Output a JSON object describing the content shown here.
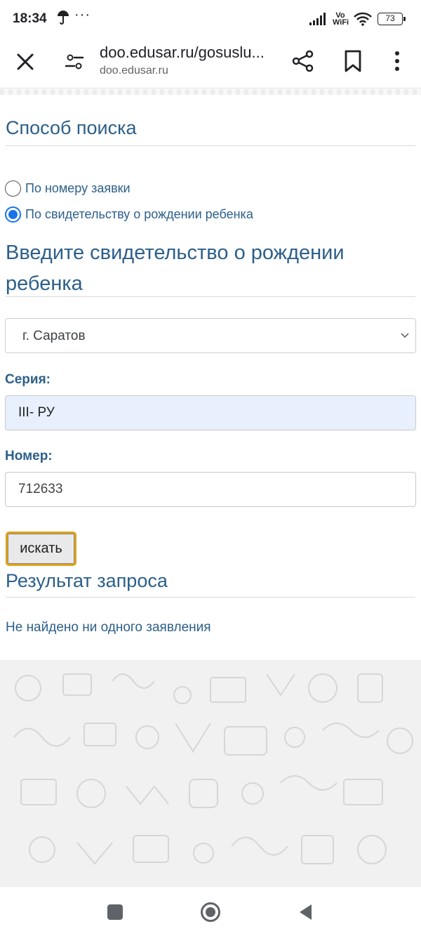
{
  "status_bar": {
    "time": "18:34",
    "dots": "···",
    "network_label_1": "Vo",
    "network_label_2": "WiFi",
    "battery": "73"
  },
  "browser": {
    "url": "doo.edusar.ru/gosuslu...",
    "domain": "doo.edusar.ru",
    "icons": [
      "close-icon",
      "tune-icon",
      "share-icon",
      "bookmark-icon",
      "more-vert-icon"
    ]
  },
  "search_method": {
    "title": "Способ поиска",
    "options": [
      {
        "label": "По номеру заявки",
        "checked": false
      },
      {
        "label": "По свидетельству о рождении ребенка",
        "checked": true
      }
    ]
  },
  "certificate": {
    "title_line1": "Введите свидетельство о рождении",
    "title_line2": "ребенка",
    "city_selected": "г. Саратов",
    "series_label": "Серия:",
    "series_value": "III- РУ",
    "number_label": "Номер:",
    "number_value": "712633",
    "search_button": "искать"
  },
  "result": {
    "title": "Результат запроса",
    "message": "Не найдено ни одного заявления"
  },
  "colors": {
    "heading": "#2c5f8a",
    "radio_accent": "#1a73e8",
    "button_focus": "#e0a21a",
    "autofill": "#e8f0fe"
  }
}
